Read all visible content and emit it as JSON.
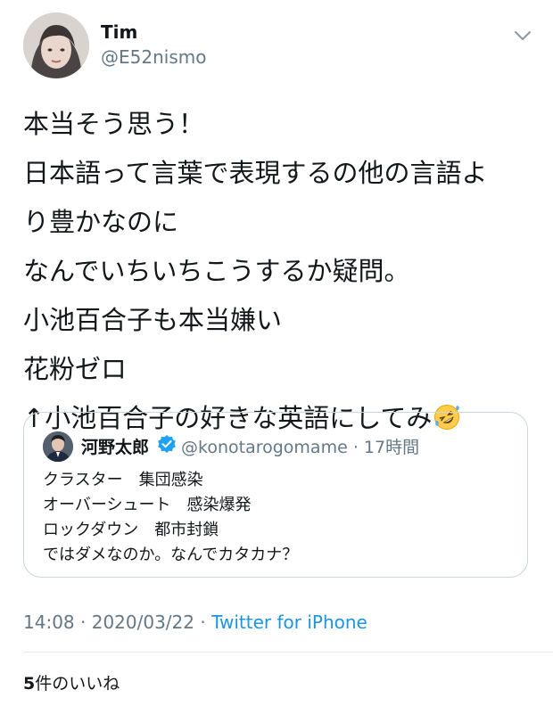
{
  "author": {
    "name": "Tim",
    "handle": "@E52nismo"
  },
  "tweet": {
    "lines": [
      "本当そう思う！",
      "日本語って言葉で表現するの他の言語よ",
      "り豊かなのに",
      "なんでいちいちこうするか疑問。",
      "小池百合子も本当嫌い",
      "花粉ゼロ",
      "↑小池百合子の好きな英語にしてみ"
    ],
    "emoji": "rolling-on-floor-laughing-emoji"
  },
  "quote": {
    "name": "河野太郎",
    "handle": "@konotarogomame",
    "time": "17時間",
    "separator": "·",
    "lines": [
      "クラスター　集団感染",
      "オーバーシュート　感染爆発",
      "ロックダウン　都市封鎖",
      "ではダメなのか。なんでカタカナ？"
    ]
  },
  "meta": {
    "time": "14:08",
    "date": "2020/03/22",
    "separator": "·",
    "source": "Twitter for iPhone"
  },
  "likes": {
    "count": "5",
    "label": "件のいいね"
  },
  "colors": {
    "text": "#14171a",
    "secondary": "#657786",
    "link": "#1b95e0",
    "verified": "#1da1f2",
    "border": "#ccd6dd"
  }
}
